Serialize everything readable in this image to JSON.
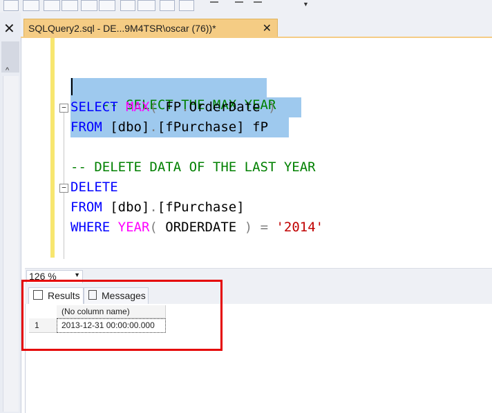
{
  "editor_tab": {
    "title": "SQLQuery2.sql - DE...9M4TSR\\oscar (76))*",
    "close": "✕"
  },
  "code": {
    "line1": "-- SELECT THE MAX YEAR",
    "line2_kw": "SELECT",
    "line2_fn": "MAX",
    "line2_p1": "(",
    "line2_a": " FP",
    "line2_dot": ".",
    "line2_b": "OrderDate ",
    "line2_p2": ")",
    "line3_kw": "FROM",
    "line3_a": " [dbo]",
    "line3_dot": ".",
    "line3_b": "[fPurchase] fP",
    "line5": "-- DELETE DATA OF THE LAST YEAR",
    "line6_kw": "DELETE",
    "line7_kw": "FROM",
    "line7_a": " [dbo]",
    "line7_dot": ".",
    "line7_b": "[fPurchase]",
    "line8_kw": "WHERE",
    "line8_fn": " YEAR",
    "line8_p1": "(",
    "line8_a": " ORDERDATE ",
    "line8_p2": ")",
    "line8_eq": " = ",
    "line8_str": "'2014'"
  },
  "zoom": {
    "value": "126 %",
    "dropdown": "▼"
  },
  "results_tabs": {
    "results": "Results",
    "messages": "Messages"
  },
  "results_grid": {
    "columns": [
      "(No column name)"
    ],
    "rows": [
      {
        "row_number": "1",
        "values": [
          "2013-12-31 00:00:00.000"
        ]
      }
    ]
  },
  "left_dock": {
    "close": "✕",
    "caret": "^"
  },
  "colors": {
    "keyword": "#0000ff",
    "function": "#ff00ff",
    "comment": "#008000",
    "string": "#c00000",
    "selection": "#9ec9ee",
    "tab_active": "#f5cc84",
    "highlight_box": "#e50000"
  }
}
